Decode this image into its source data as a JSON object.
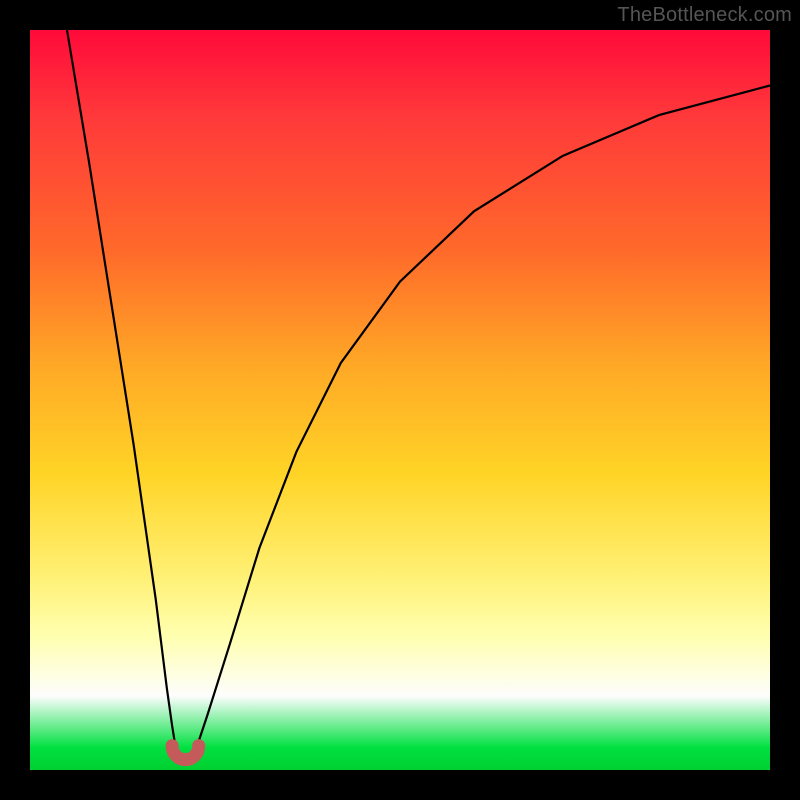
{
  "attribution": "TheBottleneck.com",
  "chart_data": {
    "type": "line",
    "title": "",
    "xlabel": "",
    "ylabel": "",
    "xlim": [
      0,
      100
    ],
    "ylim": [
      0,
      100
    ],
    "grid": false,
    "legend": false,
    "series": [
      {
        "name": "left-branch",
        "x": [
          5,
          8,
          11,
          14,
          17,
          18.5,
          19.2,
          19.8,
          20.2
        ],
        "values": [
          100,
          82,
          63,
          44,
          23,
          11,
          6,
          2.3,
          1.5
        ]
      },
      {
        "name": "right-branch",
        "x": [
          21.8,
          22.5,
          24,
          27,
          31,
          36,
          42,
          50,
          60,
          72,
          85,
          100
        ],
        "values": [
          1.5,
          3,
          7.5,
          17,
          30,
          43,
          55,
          66,
          75.5,
          83,
          88.5,
          92.5
        ]
      }
    ],
    "marker": {
      "name": "optimum-cusp",
      "x_range": [
        19.2,
        22.8
      ],
      "y": 1.4,
      "color": "#c45a5a"
    },
    "colors": {
      "background_top": "#ff0a3a",
      "background_bottom": "#00d030",
      "curve": "#000000",
      "frame": "#000000"
    }
  }
}
